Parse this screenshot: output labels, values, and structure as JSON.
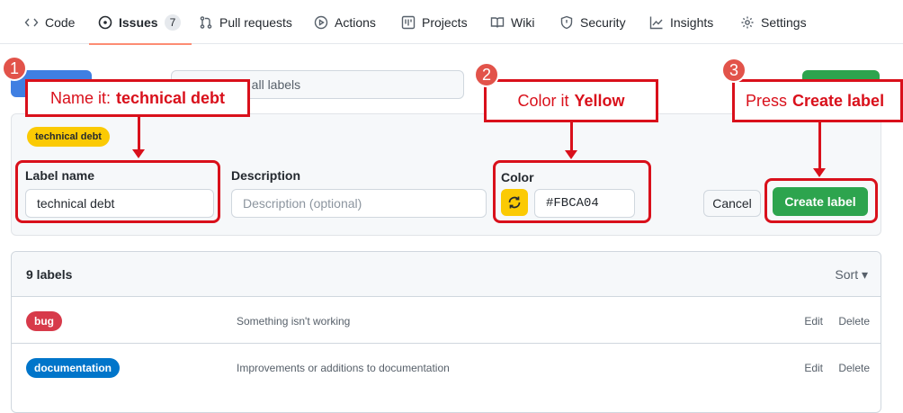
{
  "nav": {
    "tabs": [
      {
        "label": "Code",
        "icon": "code-icon"
      },
      {
        "label": "Issues",
        "icon": "issue-opened-icon",
        "count": "7"
      },
      {
        "label": "Pull requests",
        "icon": "git-pull-request-icon"
      },
      {
        "label": "Actions",
        "icon": "play-icon"
      },
      {
        "label": "Projects",
        "icon": "project-icon"
      },
      {
        "label": "Wiki",
        "icon": "book-icon"
      },
      {
        "label": "Security",
        "icon": "shield-icon"
      },
      {
        "label": "Insights",
        "icon": "graph-icon"
      },
      {
        "label": "Settings",
        "icon": "gear-icon"
      }
    ],
    "active_tab": "Issues"
  },
  "search": {
    "text": "ch all labels"
  },
  "form": {
    "preview_label": "technical debt",
    "preview_color": "#fbca04",
    "name_label": "Label name",
    "name_value": "technical debt",
    "description_label": "Description",
    "description_placeholder": "Description (optional)",
    "color_label": "Color",
    "color_value": "#FBCA04",
    "cancel_label": "Cancel",
    "create_label": "Create label"
  },
  "list": {
    "count_title": "9 labels",
    "sort_label": "Sort ▾",
    "rows": [
      {
        "name": "bug",
        "color": "#d73a4a",
        "description": "Something isn't working",
        "edit": "Edit",
        "delete": "Delete"
      },
      {
        "name": "documentation",
        "color": "#0075ca",
        "description": "Improvements or additions to documentation",
        "edit": "Edit",
        "delete": "Delete"
      }
    ]
  },
  "annotations": {
    "step1": {
      "number": "1",
      "prefix": "Name it:",
      "emphasis": "technical debt"
    },
    "step2": {
      "number": "2",
      "prefix": "Color it",
      "emphasis": "Yellow"
    },
    "step3": {
      "number": "3",
      "prefix": "Press",
      "emphasis": "Create label"
    }
  }
}
